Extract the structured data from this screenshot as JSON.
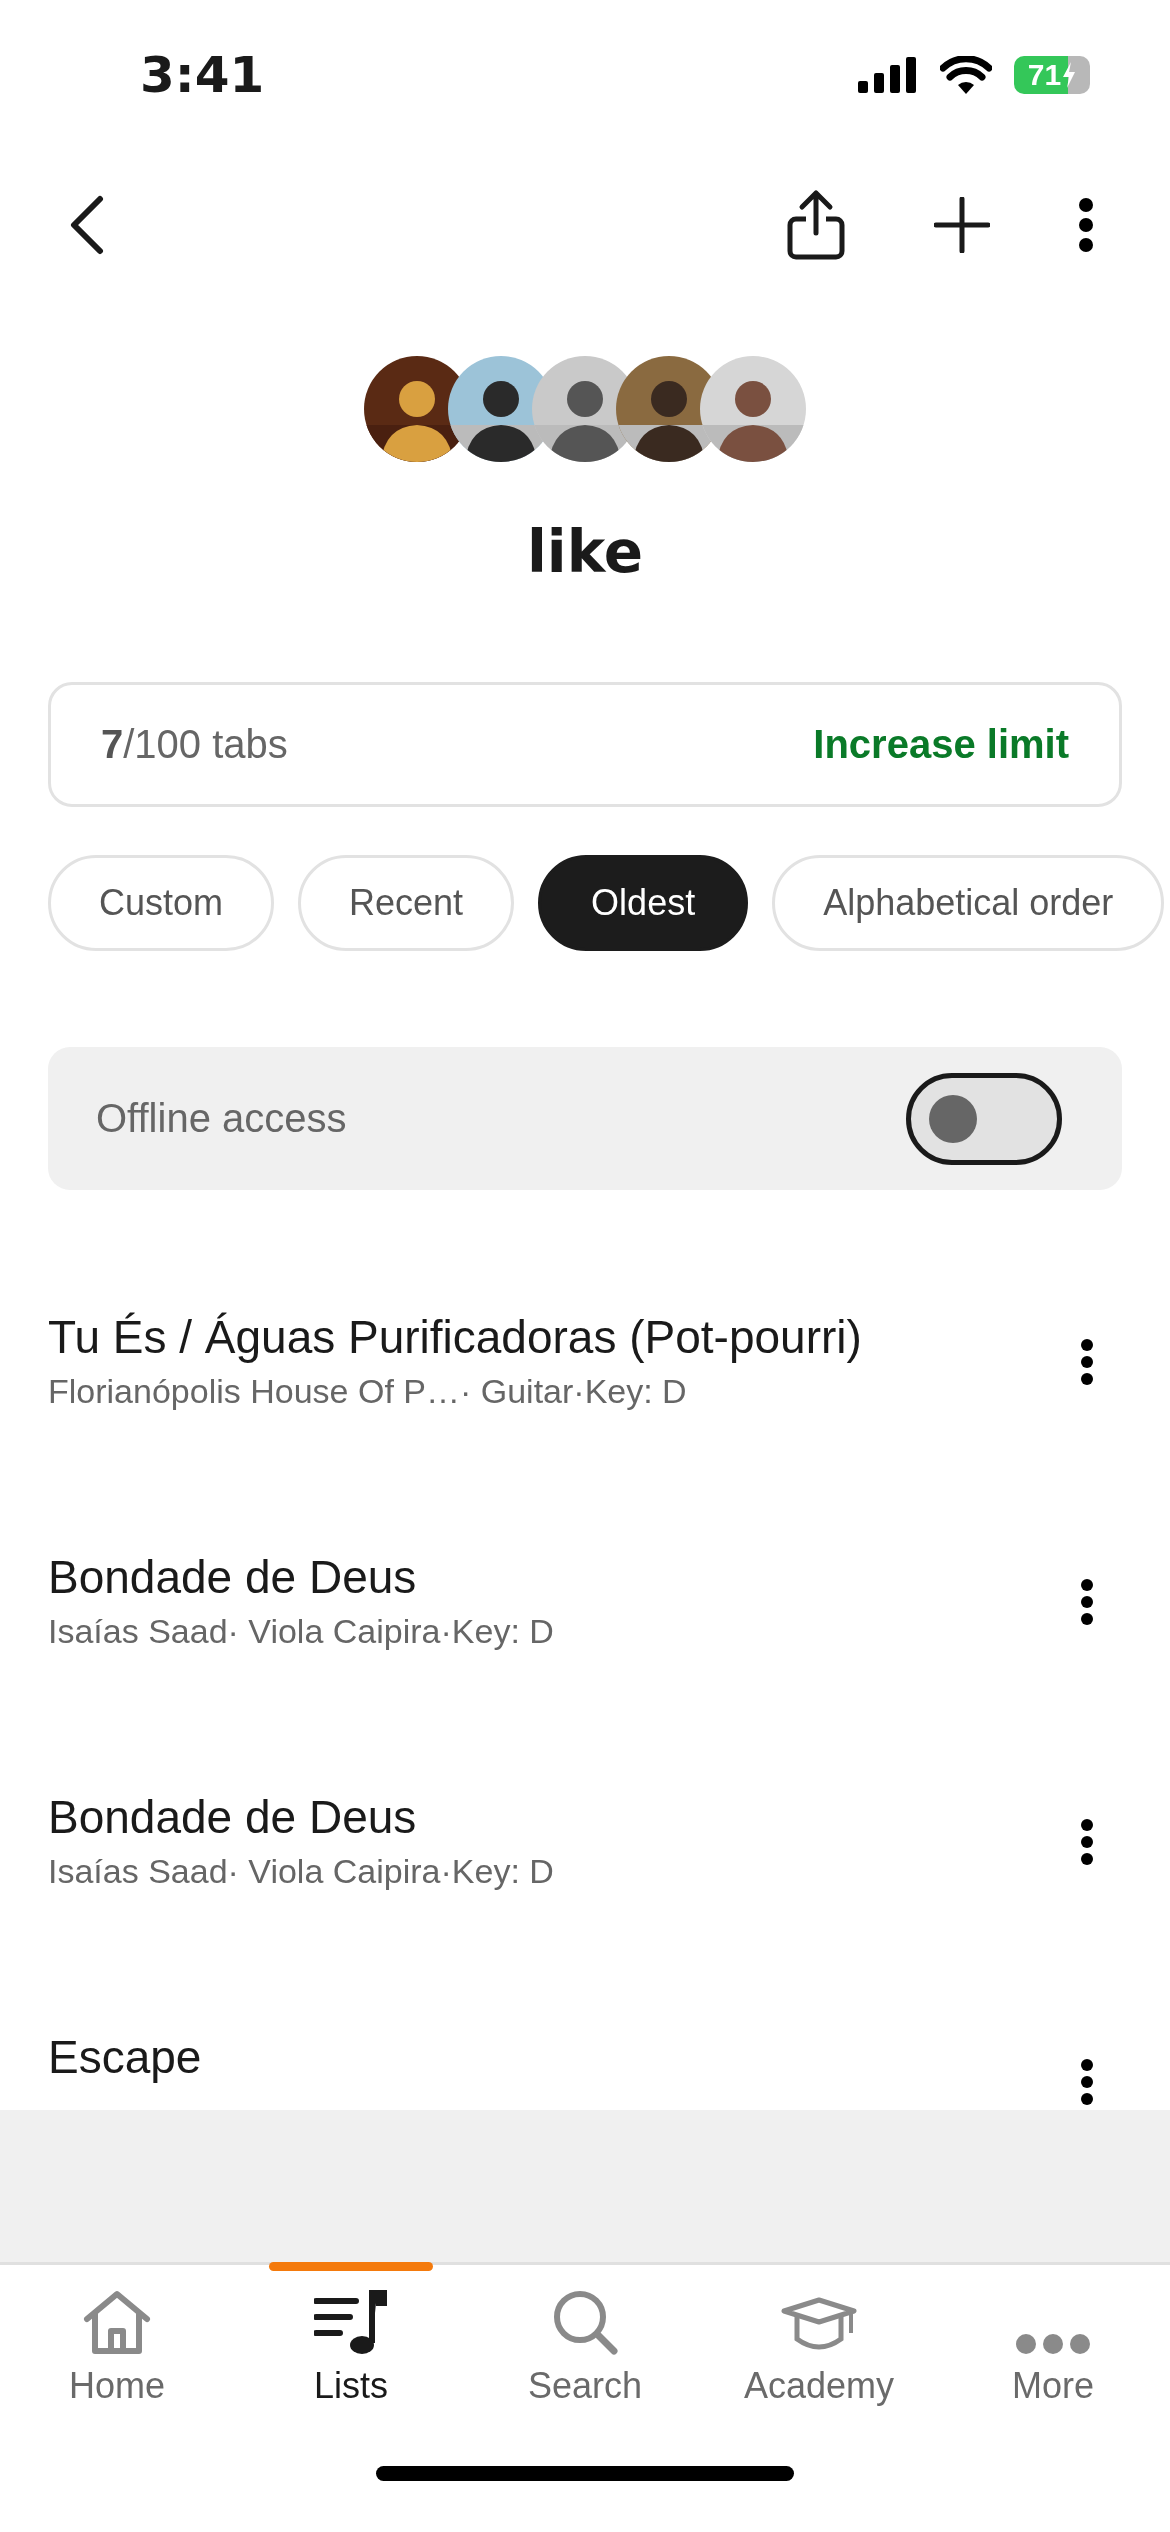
{
  "status_bar": {
    "time": "3:41",
    "battery": "71"
  },
  "list_title": "like",
  "limit": {
    "count": "7",
    "total": "/100 tabs",
    "action": "Increase limit"
  },
  "sort_chips": [
    {
      "label": "Custom",
      "selected": false
    },
    {
      "label": "Recent",
      "selected": false
    },
    {
      "label": "Oldest",
      "selected": true
    },
    {
      "label": "Alphabetical order",
      "selected": false
    }
  ],
  "offline": {
    "label": "Offline access",
    "on": false
  },
  "songs": [
    {
      "title": "Tu És / Águas Purificadoras (Pot-pourri)",
      "subtitle": "Florianópolis House Of P…· Guitar·Key: D"
    },
    {
      "title": "Bondade de Deus",
      "subtitle": "Isaías Saad· Viola Caipira·Key: D"
    },
    {
      "title": "Bondade de Deus",
      "subtitle": "Isaías Saad· Viola Caipira·Key: D"
    },
    {
      "title": "Escape"
    }
  ],
  "nav": [
    {
      "label": "Home",
      "kind": "home",
      "selected": false
    },
    {
      "label": "Lists",
      "kind": "lists",
      "selected": true
    },
    {
      "label": "Search",
      "kind": "search",
      "selected": false
    },
    {
      "label": "Academy",
      "kind": "academy",
      "selected": false
    },
    {
      "label": "More",
      "kind": "more",
      "selected": false
    }
  ]
}
